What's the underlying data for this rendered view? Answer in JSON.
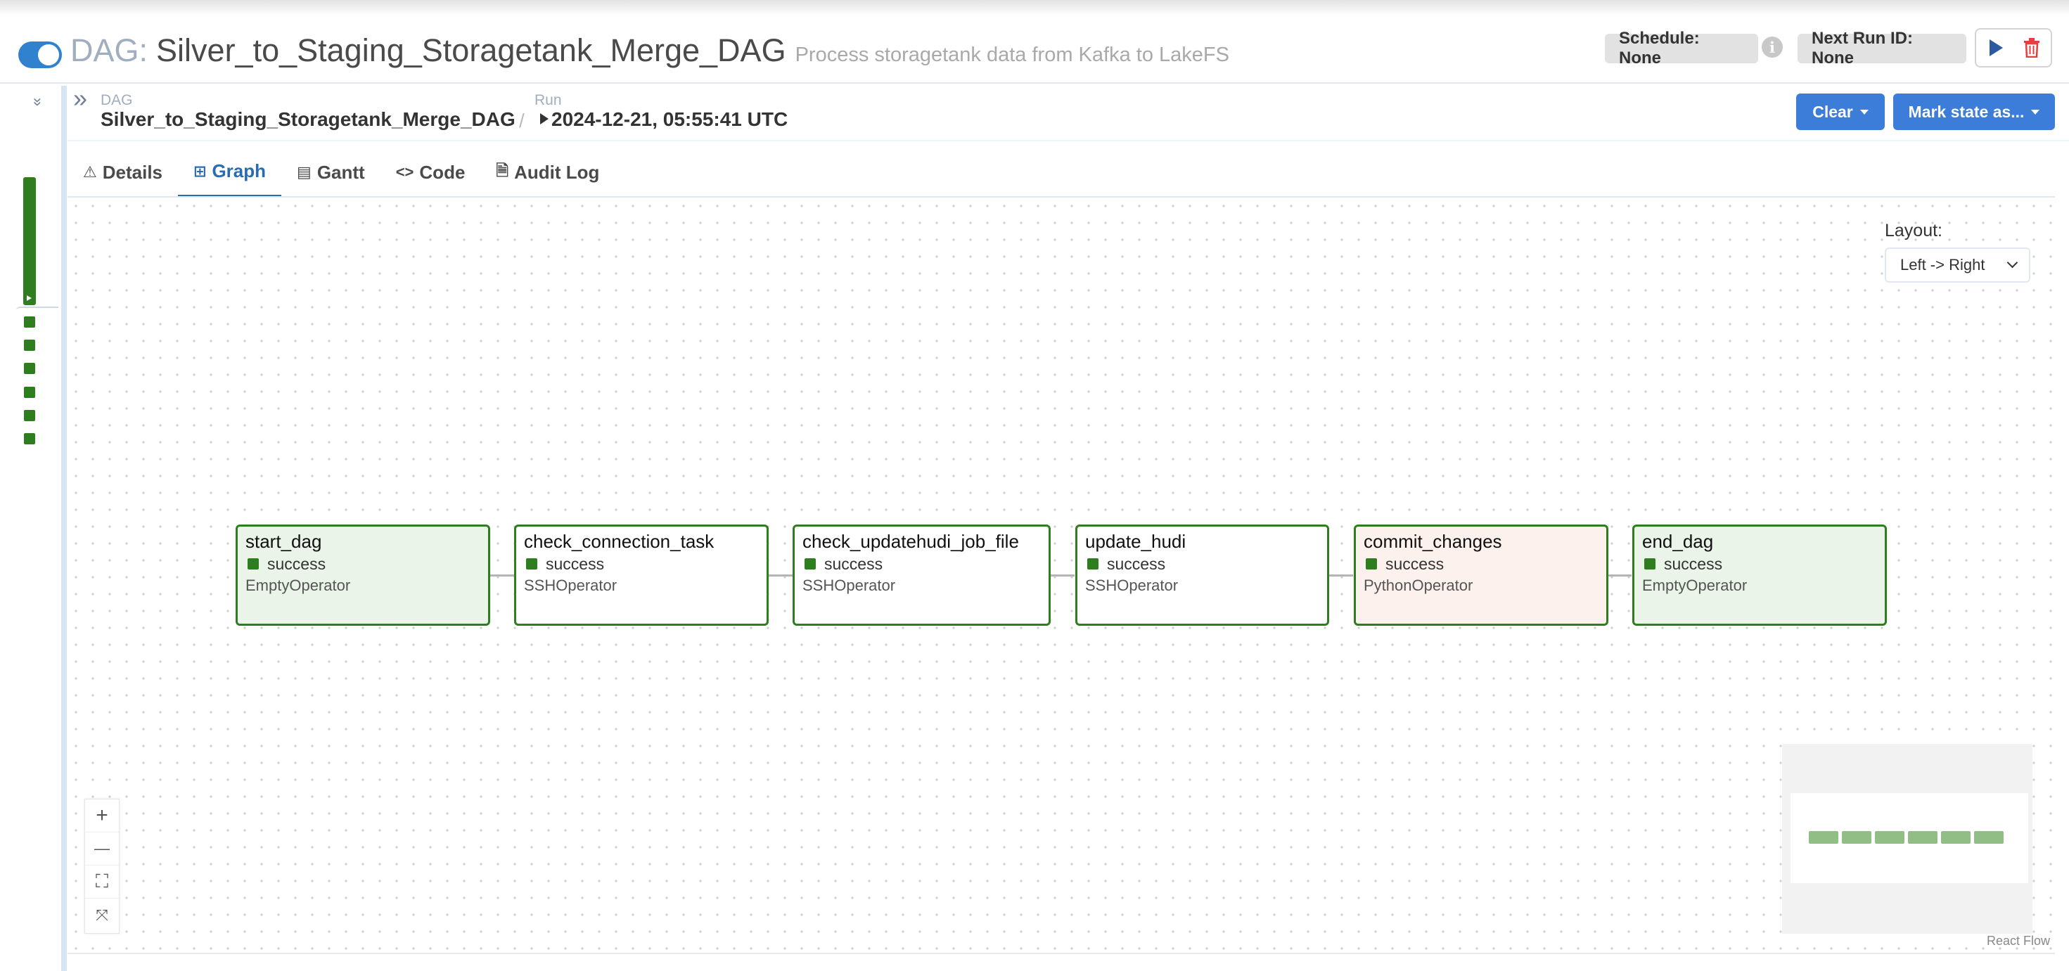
{
  "header": {
    "dag_prefix": "DAG:",
    "dag_id": "Silver_to_Staging_Storagetank_Merge_DAG",
    "description": "Process storagetank data from Kafka to LakeFS",
    "schedule": "Schedule: None",
    "info_glyph": "i",
    "next_run": "Next Run ID: None",
    "toggle_on": true
  },
  "grid": {
    "collapse_glyph": "»",
    "run_state": "success",
    "task_instance_count": 6,
    "color_success": "#2e7d1f"
  },
  "breadcrumb": {
    "expand_glyph": "»",
    "dag_label": "DAG",
    "dag_value": "Silver_to_Staging_Storagetank_Merge_DAG",
    "separator": "/",
    "run_label": "Run",
    "run_value": "2024-12-21, 05:55:41 UTC"
  },
  "actions": {
    "clear": "Clear",
    "mark_state": "Mark state as..."
  },
  "tabs": [
    {
      "label": "Details",
      "icon": "⚠"
    },
    {
      "label": "Graph",
      "icon": "⊞",
      "active": true
    },
    {
      "label": "Gantt",
      "icon": "▤"
    },
    {
      "label": "Code",
      "icon": "<>"
    },
    {
      "label": "Audit Log",
      "icon": "🗎"
    }
  ],
  "layout": {
    "label": "Layout:",
    "value": "Left -> Right"
  },
  "nodes": [
    {
      "name": "start_dag",
      "state": "success",
      "operator": "EmptyOperator"
    },
    {
      "name": "check_connection_task",
      "state": "success",
      "operator": "SSHOperator"
    },
    {
      "name": "check_updatehudi_job_file",
      "state": "success",
      "operator": "SSHOperator"
    },
    {
      "name": "update_hudi",
      "state": "success",
      "operator": "SSHOperator"
    },
    {
      "name": "commit_changes",
      "state": "success",
      "operator": "PythonOperator"
    },
    {
      "name": "end_dag",
      "state": "success",
      "operator": "EmptyOperator"
    }
  ],
  "controls": {
    "zoom_in": "+",
    "zoom_out": "—",
    "fit": "⛶",
    "lock": "⤧"
  },
  "minimap": {
    "attribution": "React Flow"
  },
  "colors": {
    "accent": "#3b7dd8",
    "success": "#2e7d1f",
    "toggle": "#3182ce",
    "delete": "#e53e3e"
  }
}
